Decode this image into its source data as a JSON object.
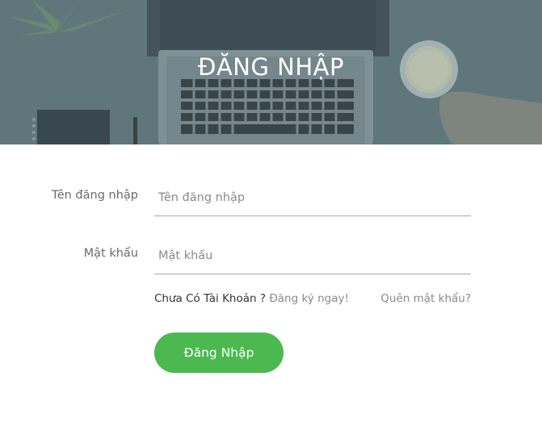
{
  "header": {
    "title": "ĐĂNG NHẬP"
  },
  "form": {
    "username": {
      "label": "Tên đăng nhập",
      "placeholder": "Tên đăng nhập",
      "value": ""
    },
    "password": {
      "label": "Mật khẩu",
      "placeholder": "Mật khẩu",
      "value": ""
    },
    "no_account_text": "Chưa Có Tài Khoản ?",
    "register_link": "Đăng ký ngay!",
    "forgot_link": "Quên mật khẩu?",
    "submit_label": "Đăng Nhập"
  },
  "colors": {
    "accent": "#4cb850",
    "banner_overlay": "#5a7478"
  },
  "icons": {
    "banner_image": "laptop-desk-photo"
  }
}
